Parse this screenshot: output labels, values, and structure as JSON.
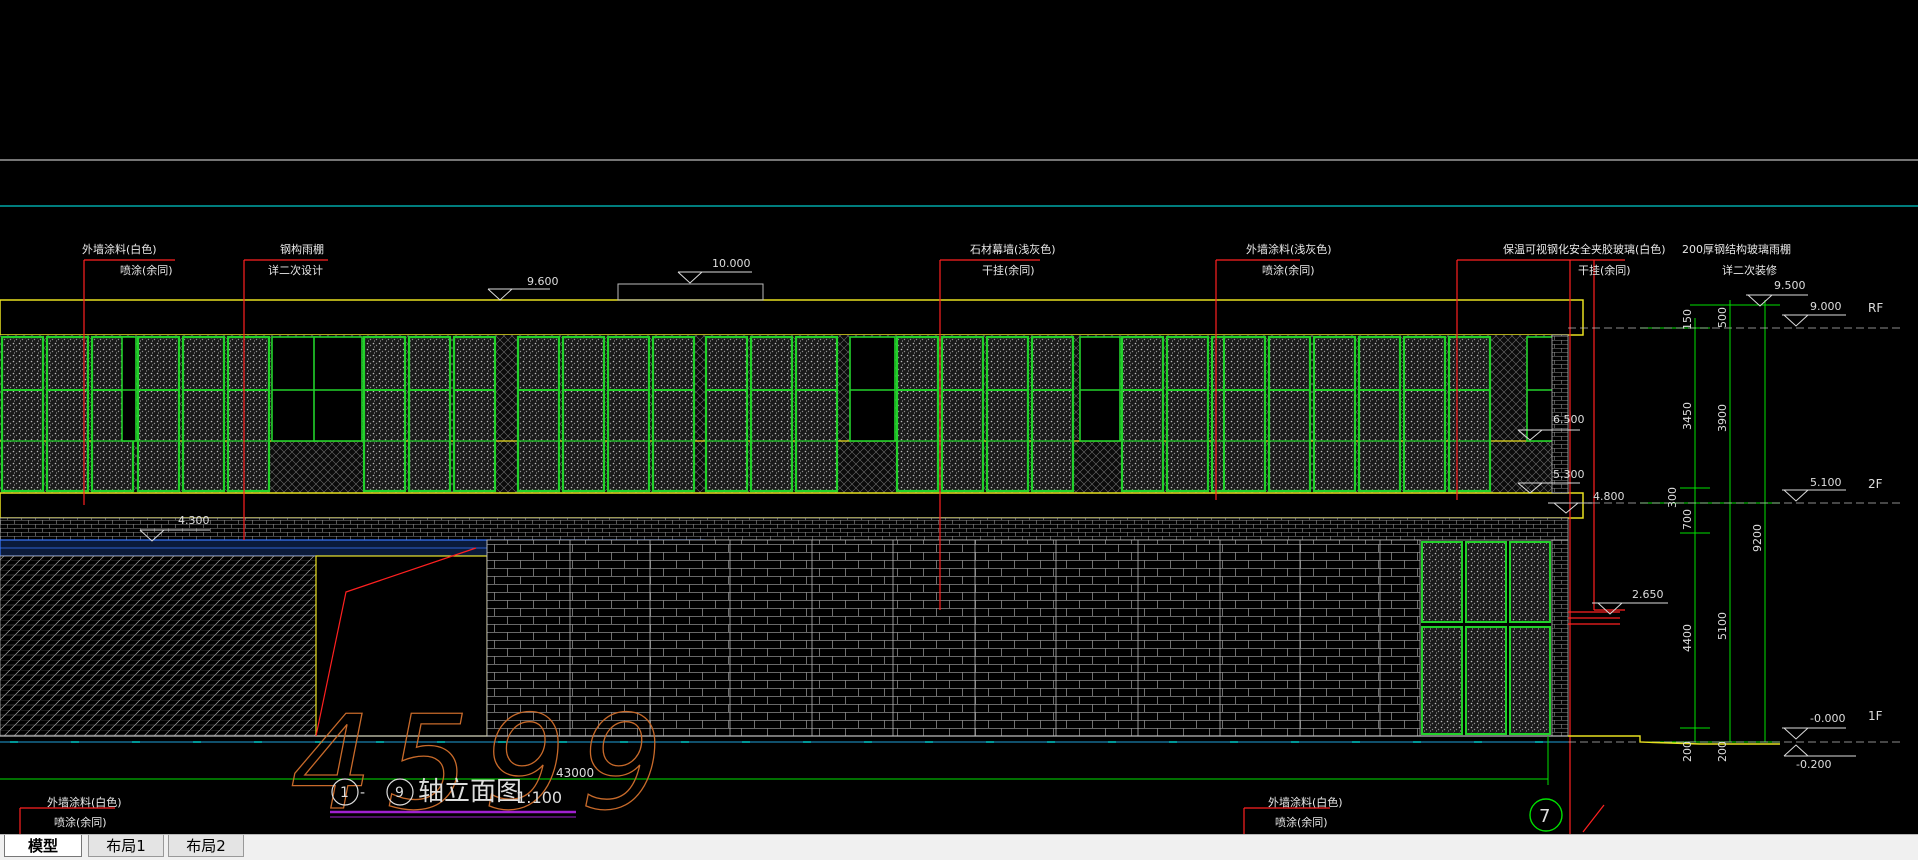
{
  "annotations": {
    "top": [
      {
        "line1": "外墙涂料(白色)",
        "line2": "喷涂(余同)"
      },
      {
        "line1": "钢构雨棚",
        "line2": "详二次设计"
      },
      {
        "line1": "石材幕墙(浅灰色)",
        "line2": "干挂(余同)"
      },
      {
        "line1": "外墙涂料(浅灰色)",
        "line2": "喷涂(余同)"
      },
      {
        "line1": "保温可视钢化安全夹胶玻璃(白色)",
        "line2": "干挂(余同)"
      },
      {
        "line1": "200厚钢结构玻璃雨棚",
        "line2": "详二次装修"
      }
    ],
    "bottom": [
      {
        "line1": "外墙涂料(白色)",
        "line2": "喷涂(余同)"
      },
      {
        "line1": "外墙涂料(白色)",
        "line2": "喷涂(余同)"
      }
    ]
  },
  "elevations": {
    "e9600": "9.600",
    "e10000": "10.000",
    "e4300": "4.300",
    "e6500": "6.500",
    "e5300": "5.300",
    "e4800": "4.800",
    "e2650": "2.650",
    "r9500": "9.500",
    "r9000": "9.000",
    "r5100": "5.100",
    "r0000": "-0.000",
    "rm0200": "-0.200"
  },
  "floors": {
    "rf": "RF",
    "f2": "2F",
    "f1": "1F"
  },
  "dimensions": {
    "d150": "150",
    "d3450": "3450",
    "d300": "300",
    "d700": "700",
    "d4400": "4400",
    "d200a": "200",
    "d500": "500",
    "d3900": "3900",
    "d5100": "5100",
    "d200b": "200",
    "d9200": "9200",
    "total": "43000"
  },
  "title": {
    "axis_from": "1",
    "dash": "-",
    "axis_to": "9",
    "name": "轴立面图",
    "scale": "1:100"
  },
  "handwriting": {
    "text": "4599"
  },
  "axis_bubble": "7",
  "tabs": [
    {
      "label": "模型",
      "active": true
    },
    {
      "label": "布局1",
      "active": false
    },
    {
      "label": "布局2",
      "active": false
    }
  ],
  "colors": {
    "background": "#000000",
    "glass_frame": "#22d12a",
    "slab": "#e8e020",
    "leader": "#ff2020",
    "dimension": "#00e000",
    "guide_cyan": "#00c8c8",
    "handwriting": "#c86a2a"
  }
}
